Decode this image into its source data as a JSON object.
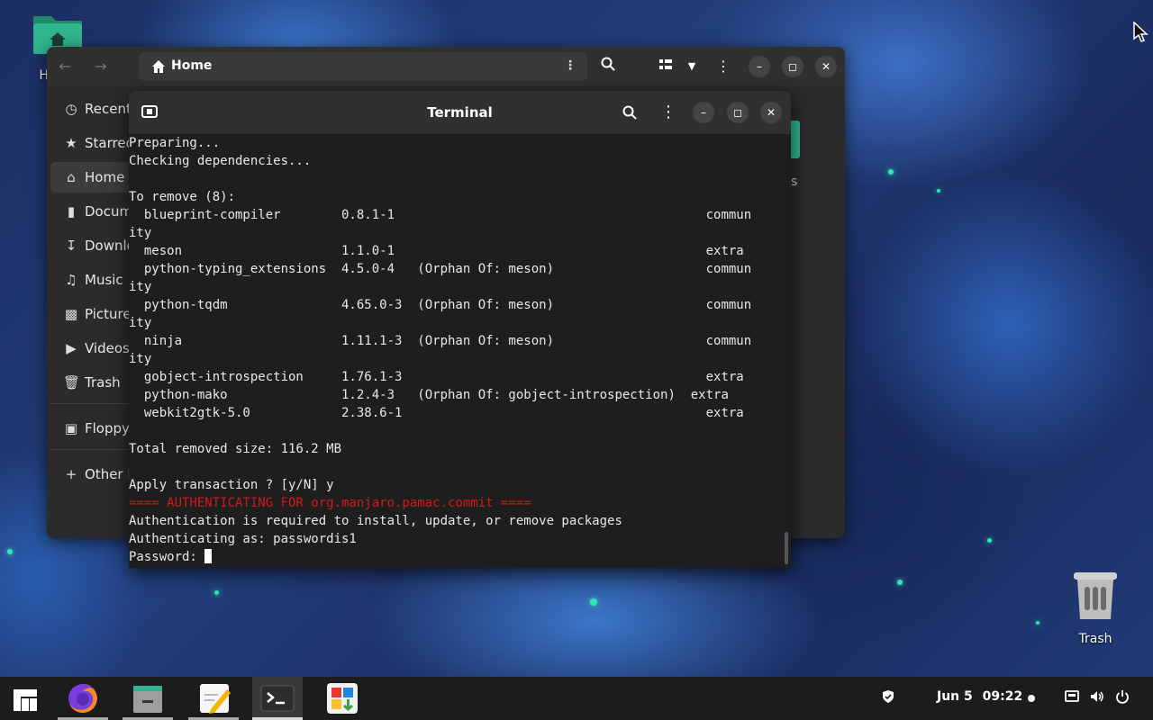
{
  "desktop": {
    "home_icon_label": "Home",
    "trash_label": "Trash"
  },
  "files": {
    "path": "Home",
    "sidebar": [
      {
        "label": "Recent",
        "icon": "clock-icon"
      },
      {
        "label": "Starred",
        "icon": "star-icon"
      },
      {
        "label": "Home",
        "icon": "home-icon",
        "active": true
      },
      {
        "label": "Documents",
        "icon": "document-icon"
      },
      {
        "label": "Downloads",
        "icon": "download-icon"
      },
      {
        "label": "Music",
        "icon": "music-icon"
      },
      {
        "label": "Pictures",
        "icon": "picture-icon"
      },
      {
        "label": "Videos",
        "icon": "video-icon"
      },
      {
        "label": "Trash",
        "icon": "trash-icon"
      },
      {
        "label": "Floppy",
        "icon": "floppy-icon"
      },
      {
        "label": "Other Locations",
        "icon": "plus-icon"
      }
    ],
    "partial_folder_label": "s"
  },
  "terminal": {
    "title": "Terminal",
    "lines": [
      "Preparing...",
      "Checking dependencies...",
      "",
      "To remove (8):",
      "  blueprint-compiler        0.8.1-1                                         commun",
      "ity",
      "  meson                     1.1.0-1                                         extra",
      "  python-typing_extensions  4.5.0-4   (Orphan Of: meson)                    commun",
      "ity",
      "  python-tqdm               4.65.0-3  (Orphan Of: meson)                    commun",
      "ity",
      "  ninja                     1.11.1-3  (Orphan Of: meson)                    commun",
      "ity",
      "  gobject-introspection     1.76.1-3                                        extra",
      "  python-mako               1.2.4-3   (Orphan Of: gobject-introspection)  extra",
      "  webkit2gtk-5.0            2.38.6-1                                        extra",
      "",
      "Total removed size: 116.2 MB",
      "",
      "Apply transaction ? [y/N] y"
    ],
    "auth_header": "==== AUTHENTICATING FOR org.manjaro.pamac.commit ====",
    "auth_lines": [
      "Authentication is required to install, update, or remove packages",
      "Authenticating as: passwordis1"
    ],
    "password_prompt": "Password: "
  },
  "taskbar": {
    "date": "Jun 5",
    "time": "09:22",
    "apps": [
      "app-menu",
      "firefox",
      "files",
      "text-editor",
      "terminal",
      "software-center"
    ]
  },
  "colors": {
    "auth_red": "#d01b1b",
    "accent_green": "#2fb58f"
  }
}
